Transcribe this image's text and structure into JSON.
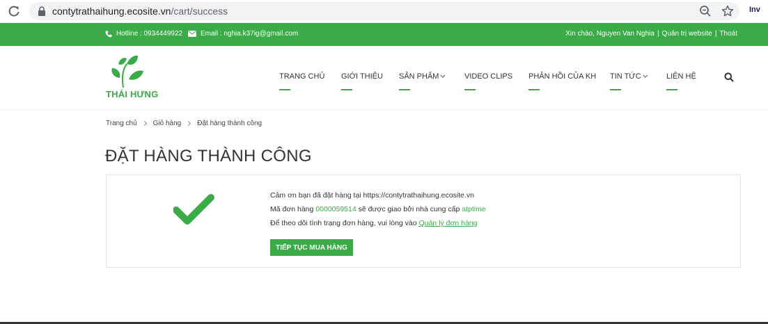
{
  "browser": {
    "url_domain": "contytrathaihung.ecosite.vn",
    "url_path": "/cart/success",
    "extension_label": "Inv"
  },
  "topbar": {
    "hotline": "Hotline : 0934449922",
    "email": "Email : nghia.k37ig@gmail.com",
    "greeting": "Xin chào, Nguyen Van Nghia",
    "admin_link": "Quản trị website",
    "logout_link": "Thoát",
    "separator": "|"
  },
  "header": {
    "logo_text": "THÁI HƯNG",
    "nav": [
      {
        "label": "TRANG CHỦ",
        "dropdown": false
      },
      {
        "label": "GIỚI THIỆU",
        "dropdown": false
      },
      {
        "label": "SẢN PHẨM",
        "dropdown": true
      },
      {
        "label": "VIDEO CLIPS",
        "dropdown": false
      },
      {
        "label": "PHẢN HỒI CỦA KH",
        "dropdown": false
      },
      {
        "label": "TIN TỨC",
        "dropdown": true
      },
      {
        "label": "LIÊN HỆ",
        "dropdown": false
      }
    ]
  },
  "breadcrumb": [
    "Trang chủ",
    "Giỏ hàng",
    "Đặt hàng thành công"
  ],
  "page": {
    "title": "ĐẶT HÀNG THÀNH CÔNG",
    "line1": "Cảm ơn bạn đã đặt hàng tại https://contytrathaihung.ecosite.vn",
    "line2_prefix": "Mã đơn hàng",
    "order_id": "0000059514",
    "line2_middle": "sẽ được giao bởi nhà cung cấp",
    "supplier": "atptime",
    "line3_prefix": "Để theo dõi tình trạng đơn hàng, vui lòng vào",
    "manage_link": "Quản lý đơn hàng",
    "continue_button": "TIẾP TỤC MUA HÀNG"
  },
  "colors": {
    "brand_green": "#3aab47",
    "text_dark": "#333333"
  }
}
